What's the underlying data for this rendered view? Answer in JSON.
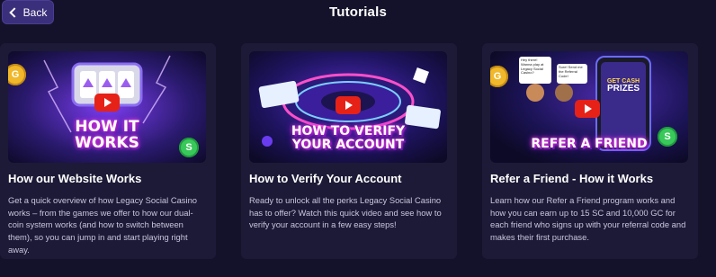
{
  "header": {
    "back_label": "Back",
    "title": "Tutorials"
  },
  "cards": [
    {
      "thumb_text_line1": "HOW IT",
      "thumb_text_line2": "WORKS",
      "title": "How our Website Works",
      "description": "Get a quick overview of how Legacy Social Casino works – from the games we offer to how our dual-coin system works (and how to switch between them), so you can jump in and start playing right away."
    },
    {
      "thumb_text_line1": "HOW TO VERIFY",
      "thumb_text_line2": "YOUR ACCOUNT",
      "title": "How to Verify Your Account",
      "description": "Ready to unlock all the perks Legacy Social Casino has to offer? Watch this quick video and see how to verify your account in a few easy steps!"
    },
    {
      "thumb_text_line1": "REFER A FRIEND",
      "bubble1": "Hey there! Wanna play at Legacy Social Casino?",
      "bubble2": "Sure! Send me the Referral Code!",
      "phone_text1": "GET CASH",
      "phone_text2": "PRIZES",
      "title": "Refer a Friend - How it Works",
      "description": "Learn how our Refer a Friend program works and how you can earn up to 15 SC and 10,000 GC for each friend who signs up with your referral code and makes their first purchase."
    }
  ],
  "coins": {
    "gold_letter": "G",
    "sweep_letter": "S"
  },
  "colors": {
    "background": "#14122a",
    "card": "#1c1a36",
    "back_button": "#3a2f7a",
    "play_red": "#e62117"
  }
}
